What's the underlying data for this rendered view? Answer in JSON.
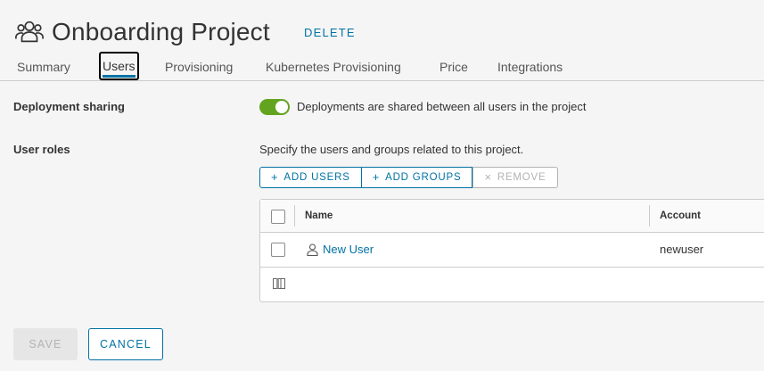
{
  "project": {
    "title": "Onboarding Project",
    "icon": "users-group-icon",
    "delete_label": "DELETE"
  },
  "tabs": [
    {
      "label": "Summary",
      "active": false
    },
    {
      "label": "Users",
      "active": true
    },
    {
      "label": "Provisioning",
      "active": false
    },
    {
      "label": "Kubernetes Provisioning",
      "active": false
    },
    {
      "label": "Price",
      "active": false
    },
    {
      "label": "Integrations",
      "active": false
    }
  ],
  "deployment_sharing": {
    "label": "Deployment sharing",
    "enabled": true,
    "description": "Deployments are shared between all users in the project"
  },
  "user_roles": {
    "label": "User roles",
    "description": "Specify the users and groups related to this project.",
    "buttons": {
      "add_users": "ADD USERS",
      "add_groups": "ADD GROUPS",
      "remove": "REMOVE"
    },
    "table": {
      "columns": [
        "Name",
        "Account"
      ],
      "rows": [
        {
          "name": "New User",
          "account": "newuser",
          "checked": false
        }
      ]
    }
  },
  "footer": {
    "save_label": "SAVE",
    "save_disabled": true,
    "cancel_label": "CANCEL"
  },
  "colors": {
    "accent": "#0072a3",
    "toggle_on": "#62a420"
  }
}
